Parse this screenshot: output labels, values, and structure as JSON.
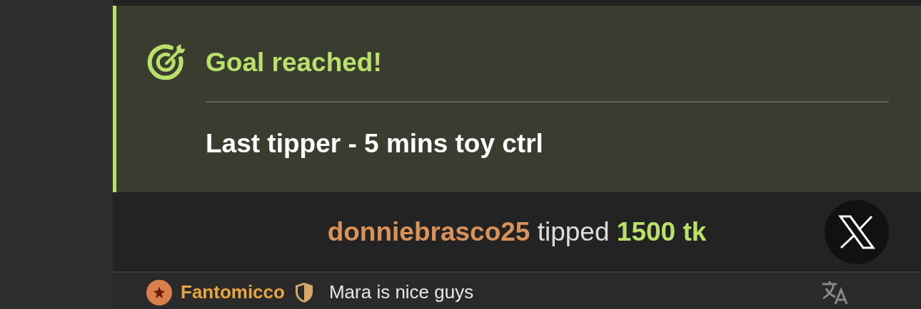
{
  "goal": {
    "title": "Goal reached!",
    "description": "Last tipper - 5 mins toy ctrl"
  },
  "tip": {
    "username": "donniebrasco25",
    "action": "tipped",
    "amount": "1500 tk"
  },
  "messages": [
    {
      "username": "Fantomicco",
      "text": "Mara is nice guys"
    }
  ]
}
